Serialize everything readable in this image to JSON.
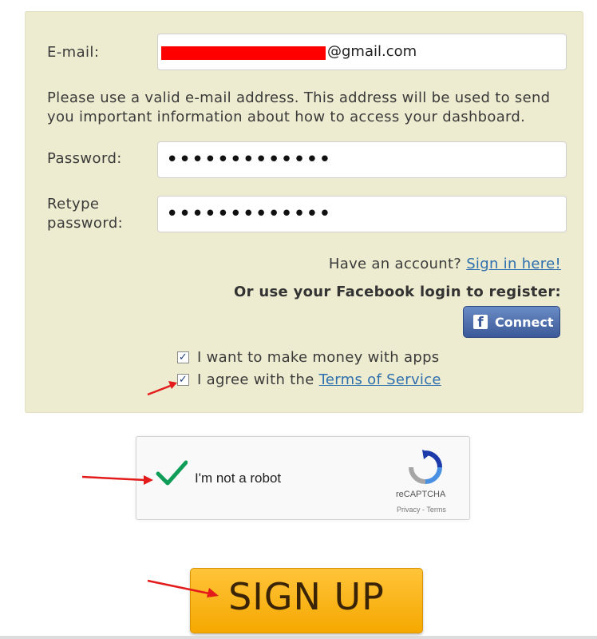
{
  "form": {
    "email_label": "E-mail:",
    "email_value": "@gmail.com",
    "help_text": "Please use a valid e-mail address. This address will be used to send you important information about how to access your dashboard.",
    "password_label": "Password:",
    "password_value": "•••••••••••••",
    "retype_label_line1": "Retype",
    "retype_label_line2": "password:",
    "retype_value": "•••••••••••••",
    "have_account_text": "Have an account?",
    "sign_in_link": "Sign in here!",
    "facebook_prompt": "Or use your Facebook login to register:",
    "facebook_icon": "f",
    "facebook_button": "Connect",
    "check_money_label": "I want to make money with apps",
    "check_terms_prefix": "I agree with the",
    "terms_link": "Terms of Service",
    "check_mark": "✓"
  },
  "captcha": {
    "label": "I'm not a robot",
    "brand": "reCAPTCHA",
    "links": "Privacy - Terms"
  },
  "signup": {
    "label": "SIGN UP"
  },
  "colors": {
    "panel": "#eeecd0",
    "link": "#2d6fae",
    "facebook": "#3b5998",
    "signup": "#f5a800",
    "arrow": "#e31b1b",
    "captcha_check": "#0f9d58"
  }
}
